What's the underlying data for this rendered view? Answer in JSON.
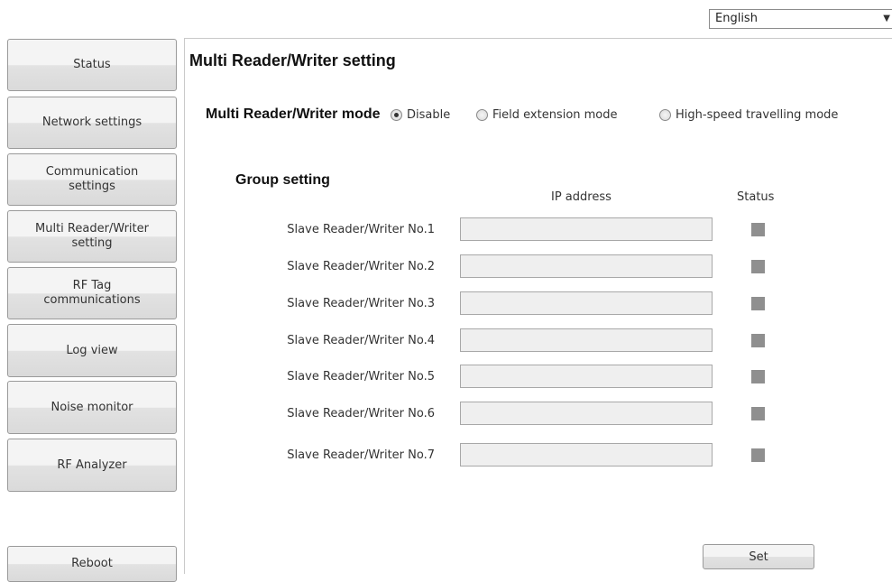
{
  "language": {
    "selected": "English"
  },
  "sidebar": {
    "items": [
      {
        "label": "Status"
      },
      {
        "label": "Network settings"
      },
      {
        "label": "Communication settings"
      },
      {
        "label": "Multi Reader/Writer setting"
      },
      {
        "label": "RF Tag communications"
      },
      {
        "label": "Log view"
      },
      {
        "label": "Noise monitor"
      },
      {
        "label": "RF Analyzer"
      }
    ],
    "reboot_label": "Reboot"
  },
  "main": {
    "title": "Multi Reader/Writer setting",
    "mode": {
      "label": "Multi Reader/Writer mode",
      "options": [
        {
          "label": "Disable",
          "checked": true
        },
        {
          "label": "Field extension mode",
          "checked": false
        },
        {
          "label": "High-speed travelling mode",
          "checked": false
        }
      ]
    },
    "group": {
      "title": "Group setting",
      "ip_header": "IP address",
      "status_header": "Status",
      "rows": [
        {
          "label": "Slave Reader/Writer No.1",
          "ip": "",
          "status_color": "#8f8f8f"
        },
        {
          "label": "Slave Reader/Writer No.2",
          "ip": "",
          "status_color": "#8f8f8f"
        },
        {
          "label": "Slave Reader/Writer No.3",
          "ip": "",
          "status_color": "#8f8f8f"
        },
        {
          "label": "Slave Reader/Writer No.4",
          "ip": "",
          "status_color": "#8f8f8f"
        },
        {
          "label": "Slave Reader/Writer No.5",
          "ip": "",
          "status_color": "#8f8f8f"
        },
        {
          "label": "Slave Reader/Writer No.6",
          "ip": "",
          "status_color": "#8f8f8f"
        },
        {
          "label": "Slave Reader/Writer No.7",
          "ip": "",
          "status_color": "#8f8f8f"
        }
      ]
    },
    "set_label": "Set"
  }
}
